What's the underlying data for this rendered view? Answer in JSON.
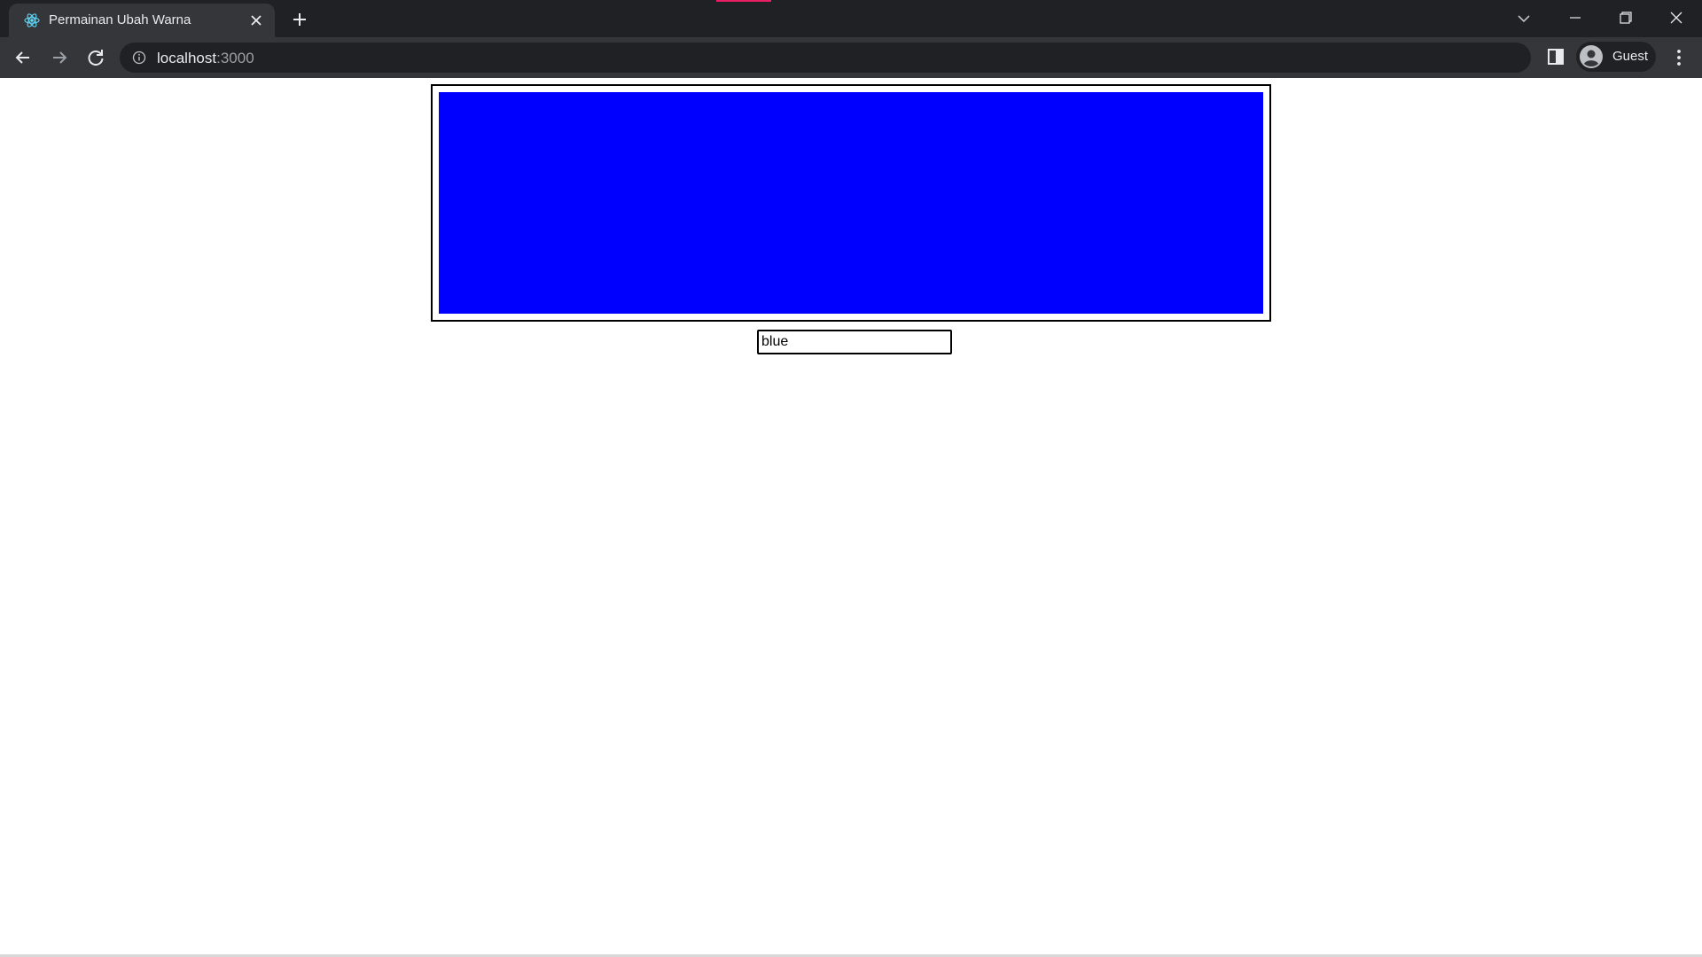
{
  "browser": {
    "tab_title": "Permainan Ubah Warna",
    "url_host": "localhost",
    "url_port": ":3000",
    "profile_label": "Guest",
    "icons": {
      "favicon": "react-logo-icon",
      "tab_close": "close-icon",
      "new_tab": "plus-icon",
      "tab_search": "chevron-down-icon",
      "back": "arrow-left-icon",
      "forward": "arrow-right-icon",
      "reload": "reload-icon",
      "site_info": "info-icon",
      "side_panel": "side-panel-icon",
      "avatar": "person-icon",
      "menu": "kebab-menu-icon"
    },
    "colors": {
      "chrome_dark": "#202124",
      "chrome_toolbar": "#35363a",
      "text_light": "#e8eaed",
      "accent": "#e91e63"
    }
  },
  "page": {
    "color_box": {
      "color": "blue",
      "fill": "#0000ff"
    },
    "color_input": {
      "value": "blue"
    }
  }
}
